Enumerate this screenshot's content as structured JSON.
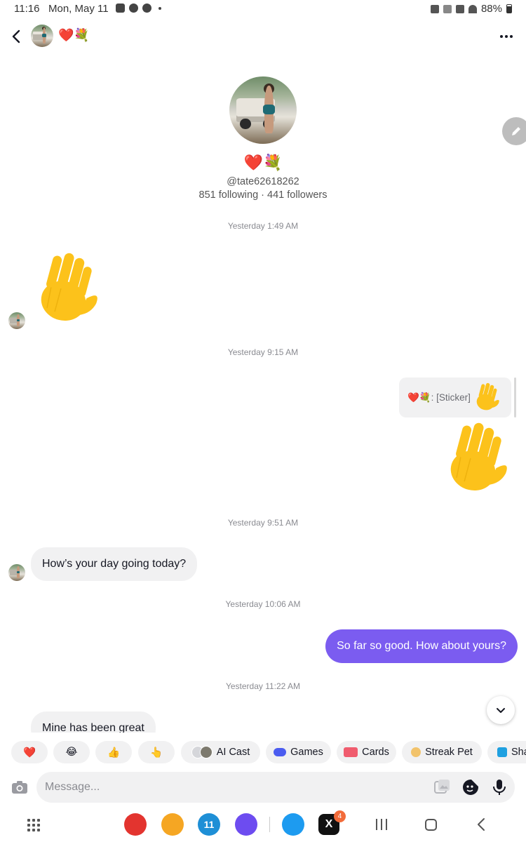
{
  "status_bar": {
    "time": "11:16",
    "date": "Mon, May 11",
    "battery": "88%"
  },
  "header": {
    "name": "❤️💐",
    "menu_icon": "more-horizontal-icon",
    "back_icon": "chevron-left-icon"
  },
  "profile": {
    "display_name": "❤️💐",
    "handle": "@tate62618262",
    "stats": "851 following · 441 followers"
  },
  "messages": [
    {
      "type": "timestamp",
      "text": "Yesterday 1:49 AM"
    },
    {
      "type": "sticker-in",
      "sticker": "waving-hand"
    },
    {
      "type": "timestamp",
      "text": "Yesterday 9:15 AM"
    },
    {
      "type": "reply-card",
      "text": "❤️💐: [Sticker]"
    },
    {
      "type": "sticker-out",
      "sticker": "waving-hand"
    },
    {
      "type": "timestamp",
      "text": "Yesterday 9:51 AM"
    },
    {
      "type": "text-in",
      "text": "How’s your day going today?"
    },
    {
      "type": "timestamp",
      "text": "Yesterday 10:06 AM"
    },
    {
      "type": "text-out",
      "text": "So far so good. How about yours?"
    },
    {
      "type": "timestamp",
      "text": "Yesterday 11:22 AM"
    },
    {
      "type": "text-in",
      "text": "Mine has been great"
    }
  ],
  "quick_actions": [
    {
      "icon": "heart-emoji",
      "label": "❤️"
    },
    {
      "icon": "laughing-emoji",
      "label": "😂"
    },
    {
      "icon": "thumbs-up-emoji",
      "label": "👍"
    },
    {
      "icon": "pointing-up-emoji",
      "label": "👆"
    },
    {
      "icon": "ai-cast-icon",
      "label": "AI Cast"
    },
    {
      "icon": "gamepad-icon",
      "label": "Games"
    },
    {
      "icon": "card-icon",
      "label": "Cards"
    },
    {
      "icon": "egg-icon",
      "label": "Streak Pet"
    },
    {
      "icon": "share-icon",
      "label": "Sha"
    }
  ],
  "composer": {
    "placeholder": "Message...",
    "icons": [
      "camera-icon",
      "gallery-icon",
      "sticker-icon",
      "microphone-icon"
    ]
  },
  "nav_bar": {
    "apps": [
      "flipboard-icon",
      "files-icon",
      "calendar-icon",
      "browser-icon",
      "twitter-icon",
      "x-icon"
    ],
    "calendar_day": "11",
    "x_badge": "4",
    "buttons": [
      "recents-icon",
      "home-icon",
      "back-icon"
    ]
  },
  "colors": {
    "outgoing_bubble": "#7b5cf0",
    "incoming_bubble": "#f1f1f2",
    "timestamp": "#8a8b91"
  }
}
